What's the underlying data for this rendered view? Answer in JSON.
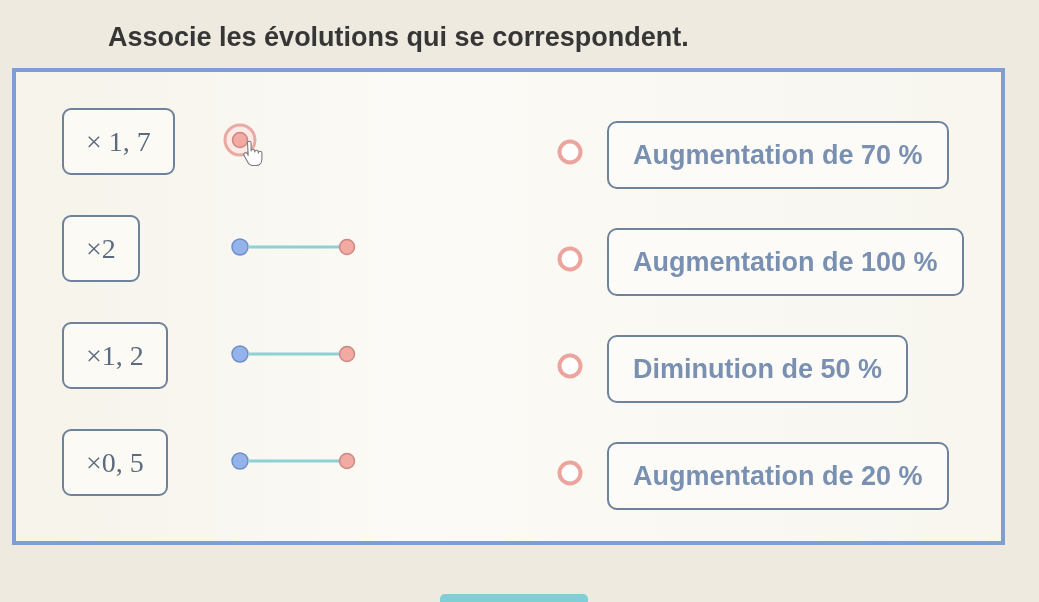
{
  "instruction": "Associe les évolutions qui se correspondent.",
  "left_items": [
    {
      "label": "× 1, 7",
      "connector_extended": false,
      "hovered": true
    },
    {
      "label": "×2",
      "connector_extended": true,
      "hovered": false
    },
    {
      "label": "×1, 2",
      "connector_extended": true,
      "hovered": false
    },
    {
      "label": "×0, 5",
      "connector_extended": true,
      "hovered": false
    }
  ],
  "right_items": [
    {
      "label": "Augmentation de 70 %"
    },
    {
      "label": "Augmentation de 100 %"
    },
    {
      "label": "Diminution de 50 %"
    },
    {
      "label": "Augmentation de 20 %"
    }
  ]
}
